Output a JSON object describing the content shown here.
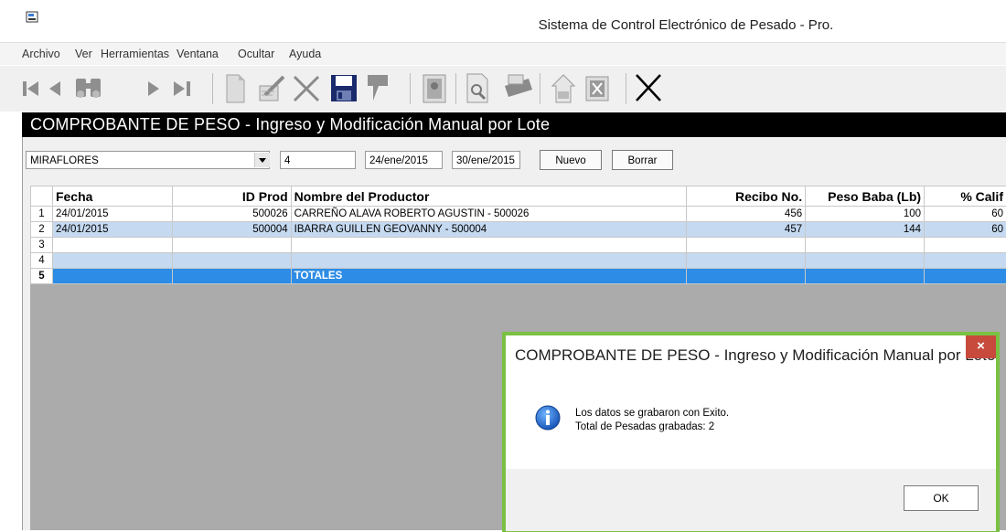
{
  "window": {
    "title": "Sistema de Control Electrónico de Pesado - Pro."
  },
  "menu": {
    "items": [
      "Archivo",
      "Ver",
      "Herramientas",
      "Ventana",
      "Ocultar",
      "Ayuda"
    ]
  },
  "toolbar": {
    "icons": [
      "first-record-icon",
      "previous-record-icon",
      "find-binoculars-icon",
      "next-record-icon",
      "last-record-icon",
      "new-document-icon",
      "edit-pen-icon",
      "delete-x-icon",
      "save-disk-icon",
      "bookmark-icon",
      "image-icon",
      "preview-icon",
      "print-icon",
      "export-icon",
      "excel-icon",
      "close-x-icon"
    ]
  },
  "form": {
    "header": "COMPROBANTE DE PESO - Ingreso y Modificación Manual por Lote",
    "location": "MIRAFLORES",
    "number": "4",
    "date_from": "24/ene/2015",
    "date_to": "30/ene/2015",
    "new_button": "Nuevo",
    "delete_button": "Borrar"
  },
  "grid": {
    "columns": [
      "Fecha",
      "ID Prod",
      "Nombre del Productor",
      "Recibo No.",
      "Peso Baba (Lb)",
      "% Calif"
    ],
    "rows": [
      {
        "n": "1",
        "fecha": "24/01/2015",
        "id": "500026",
        "nombre": "CARREÑO ALAVA ROBERTO AGUSTIN   - 500026",
        "recibo": "456",
        "peso": "100",
        "calif": "60"
      },
      {
        "n": "2",
        "fecha": "24/01/2015",
        "id": "500004",
        "nombre": "IBARRA GUILLEN GEOVANNY    - 500004",
        "recibo": "457",
        "peso": "144",
        "calif": "60"
      },
      {
        "n": "3",
        "fecha": "",
        "id": "",
        "nombre": "",
        "recibo": "",
        "peso": "",
        "calif": ""
      },
      {
        "n": "4",
        "fecha": "",
        "id": "",
        "nombre": "",
        "recibo": "",
        "peso": "",
        "calif": ""
      }
    ],
    "totals_row_number": "5",
    "totals_label": "TOTALES"
  },
  "dialog": {
    "title": "COMPROBANTE DE PESO - Ingreso y Modificación Manual por Lote",
    "close_label": "×",
    "message_line1": "Los datos se grabaron con Exito.",
    "message_line2": "Total de Pesadas grabadas: 2",
    "ok_label": "OK"
  }
}
